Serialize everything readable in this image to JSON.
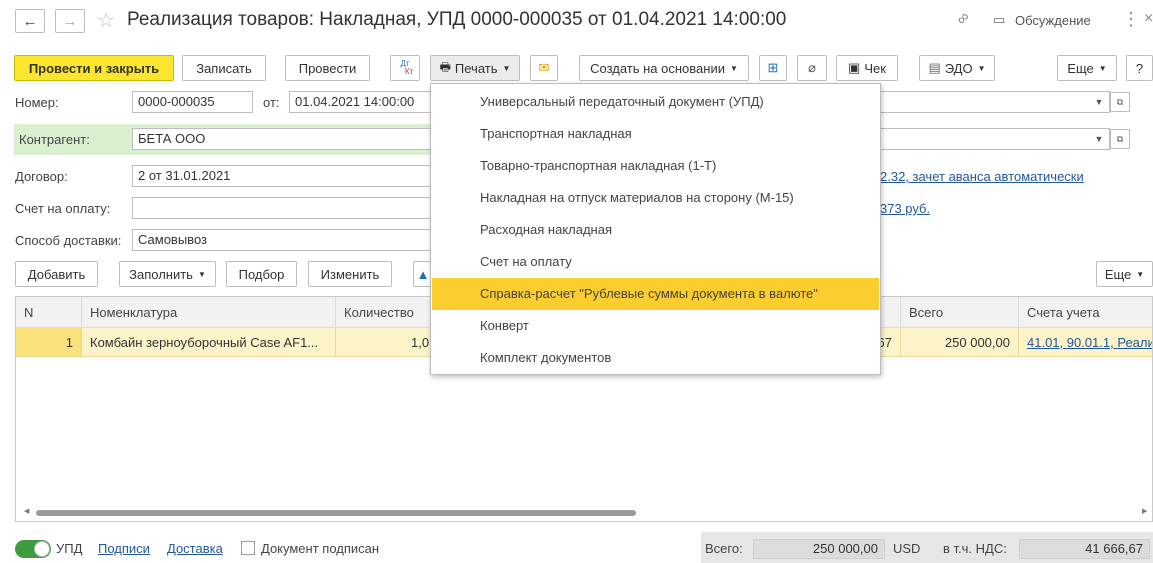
{
  "window": {
    "title": "Реализация товаров: Накладная, УПД 0000-000035 от 01.04.2021 14:00:00",
    "discussion_label": "Обсуждение"
  },
  "toolbar": {
    "post_close": "Провести и закрыть",
    "save": "Записать",
    "post": "Провести",
    "dtkt_top": "Дт",
    "dtkt_bottom": "Кт",
    "print": "Печать",
    "create_based": "Создать на основании",
    "check": "Чек",
    "edo": "ЭДО",
    "more": "Еще",
    "help": "?"
  },
  "form": {
    "number_label": "Номер:",
    "number_value": "0000-000035",
    "date_label": "от:",
    "date_value": "01.04.2021 14:00:00",
    "counterparty_label": "Контрагент:",
    "counterparty_value": "БЕТА ООО",
    "contract_label": "Договор:",
    "contract_value": "2 от 31.01.2021",
    "contract_link": "2.32, зачет аванса автоматически",
    "invoice_label": "Счет на оплату:",
    "invoice_value": "",
    "invoice_link": "373 руб.",
    "delivery_label": "Способ доставки:",
    "delivery_value": "Самовывоз"
  },
  "table_toolbar": {
    "add": "Добавить",
    "fill": "Заполнить",
    "pick": "Подбор",
    "edit": "Изменить",
    "more": "Еще"
  },
  "table": {
    "headers": {
      "n": "N",
      "item": "Номенклатура",
      "qty": "Количество",
      "total": "Всего",
      "accounts": "Счета учета"
    },
    "rows": [
      {
        "n": "1",
        "item": "Комбайн зерноуборочный Case AF1...",
        "qty": "1,0",
        "vat_fragment": "67",
        "total": "250 000,00",
        "accounts": "41.01, 90.01.1, Реали"
      }
    ]
  },
  "print_menu": {
    "items": [
      "Универсальный передаточный документ (УПД)",
      "Транспортная накладная",
      "Товарно-транспортная накладная (1-Т)",
      "Накладная на отпуск материалов на сторону (М-15)",
      "Расходная накладная",
      "Счет на оплату",
      "Справка-расчет \"Рублевые суммы документа в валюте\"",
      "Конверт",
      "Комплект документов"
    ],
    "selected_index": 6
  },
  "footer": {
    "upd_toggle": "УПД",
    "signatures": "Подписи",
    "delivery": "Доставка",
    "signed": "Документ подписан",
    "total_label": "Всего:",
    "total_value": "250 000,00",
    "currency": "USD",
    "vat_label": "в т.ч. НДС:",
    "vat_value": "41 666,67"
  },
  "colors": {
    "accent": "#fbe52e",
    "menu_selected": "#fbcd2e",
    "row_selected": "#fdf3c9",
    "link": "#23579f",
    "counterparty_bg": "#d9efcf"
  }
}
